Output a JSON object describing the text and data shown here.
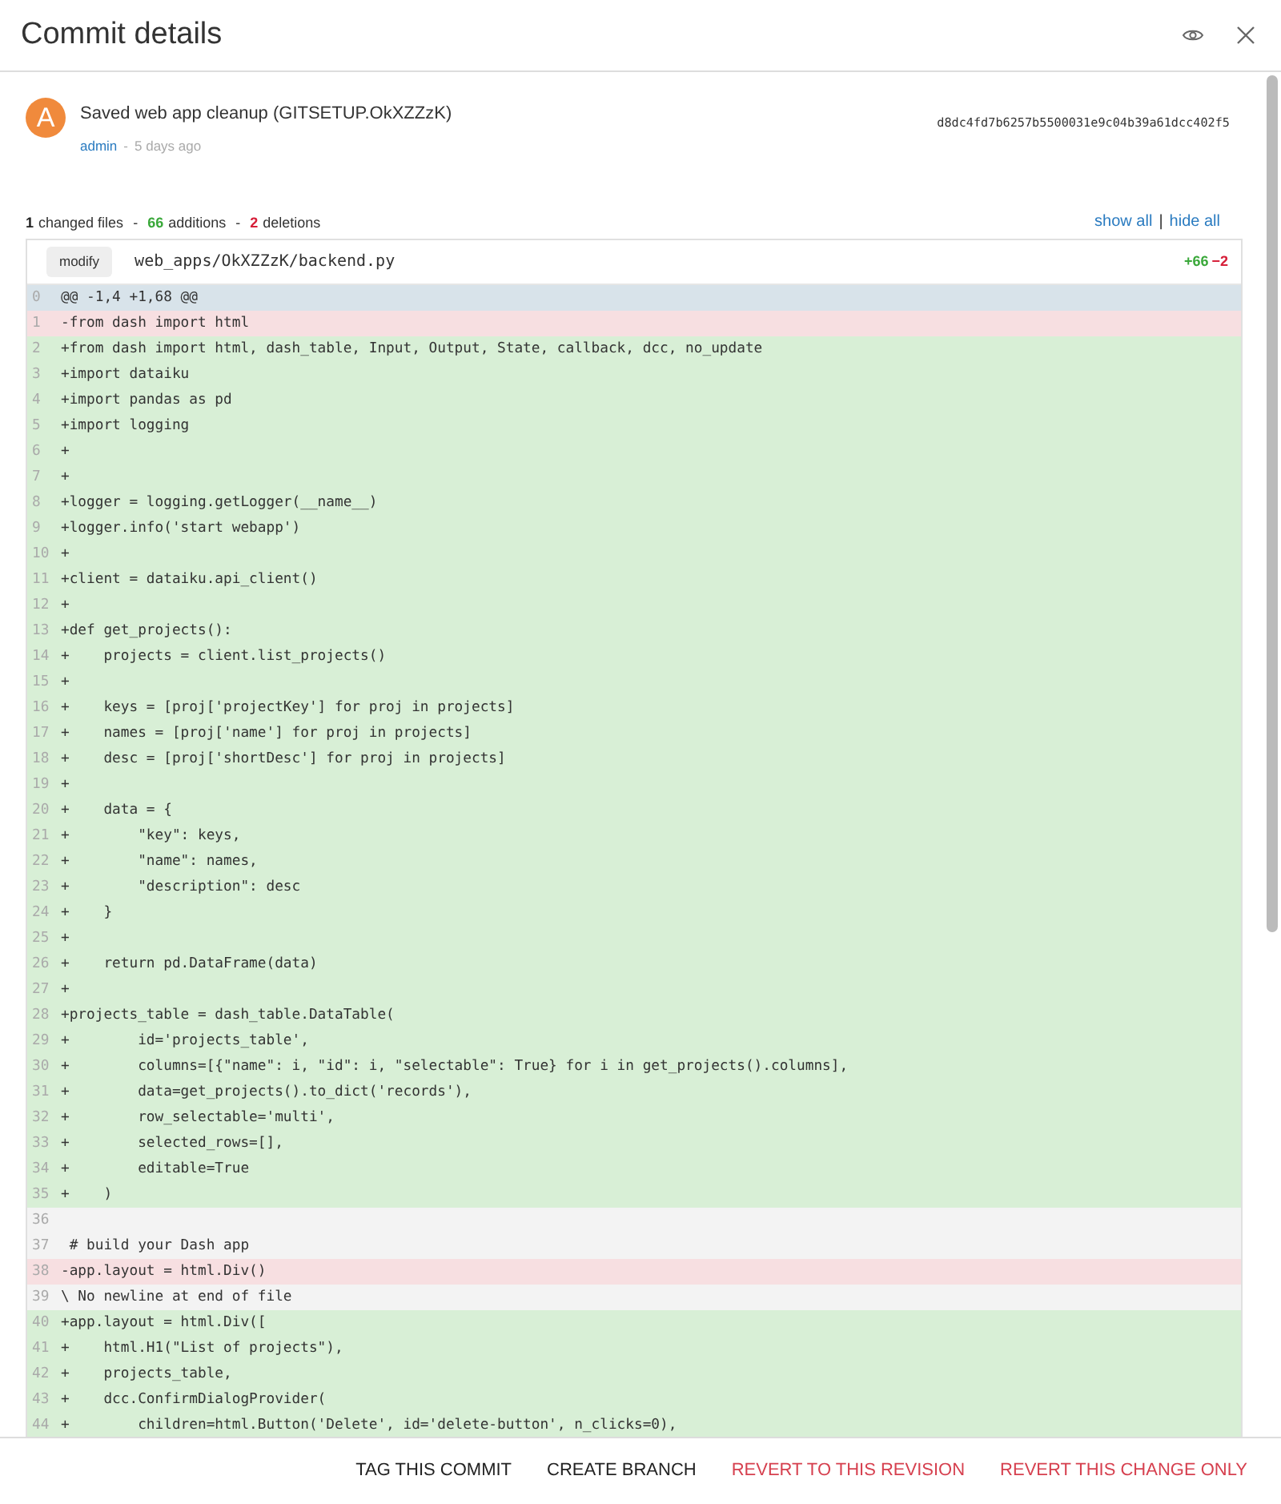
{
  "window": {
    "title": "Commit details"
  },
  "commit": {
    "avatar": "A",
    "message": "Saved web app cleanup (GITSETUP.OkXZZzK)",
    "author": "admin",
    "separator": "-",
    "time": "5 days ago",
    "hash": "d8dc4fd7b6257b5500031e9c04b39a61dcc402f5"
  },
  "stats": [
    {
      "kind": "files",
      "count": "1",
      "noun": "changed files"
    },
    {
      "kind": "additions",
      "count": "66",
      "noun": "additions"
    },
    {
      "kind": "deletions",
      "count": "2",
      "noun": "deletions"
    }
  ],
  "stats_separator": "-",
  "toggles": {
    "show": "show all",
    "divider": "|",
    "hide": "hide all"
  },
  "file": {
    "action": "modify",
    "path": "web_apps/OkXZZzK/backend.py",
    "additions": "+66",
    "deletions": "−2"
  },
  "diff": [
    {
      "no": "0",
      "kind": "hunk",
      "text": "@@ -1,4 +1,68 @@"
    },
    {
      "no": "1",
      "kind": "del",
      "text": "-from dash import html"
    },
    {
      "no": "2",
      "kind": "add",
      "text": "+from dash import html, dash_table, Input, Output, State, callback, dcc, no_update"
    },
    {
      "no": "3",
      "kind": "add",
      "text": "+import dataiku"
    },
    {
      "no": "4",
      "kind": "add",
      "text": "+import pandas as pd"
    },
    {
      "no": "5",
      "kind": "add",
      "text": "+import logging"
    },
    {
      "no": "6",
      "kind": "add",
      "text": "+"
    },
    {
      "no": "7",
      "kind": "add",
      "text": "+"
    },
    {
      "no": "8",
      "kind": "add",
      "text": "+logger = logging.getLogger(__name__)"
    },
    {
      "no": "9",
      "kind": "add",
      "text": "+logger.info('start webapp')"
    },
    {
      "no": "10",
      "kind": "add",
      "text": "+"
    },
    {
      "no": "11",
      "kind": "add",
      "text": "+client = dataiku.api_client()"
    },
    {
      "no": "12",
      "kind": "add",
      "text": "+"
    },
    {
      "no": "13",
      "kind": "add",
      "text": "+def get_projects():"
    },
    {
      "no": "14",
      "kind": "add",
      "text": "+    projects = client.list_projects()"
    },
    {
      "no": "15",
      "kind": "add",
      "text": "+"
    },
    {
      "no": "16",
      "kind": "add",
      "text": "+    keys = [proj['projectKey'] for proj in projects]"
    },
    {
      "no": "17",
      "kind": "add",
      "text": "+    names = [proj['name'] for proj in projects]"
    },
    {
      "no": "18",
      "kind": "add",
      "text": "+    desc = [proj['shortDesc'] for proj in projects]"
    },
    {
      "no": "19",
      "kind": "add",
      "text": "+"
    },
    {
      "no": "20",
      "kind": "add",
      "text": "+    data = {"
    },
    {
      "no": "21",
      "kind": "add",
      "text": "+        \"key\": keys,"
    },
    {
      "no": "22",
      "kind": "add",
      "text": "+        \"name\": names,"
    },
    {
      "no": "23",
      "kind": "add",
      "text": "+        \"description\": desc"
    },
    {
      "no": "24",
      "kind": "add",
      "text": "+    }"
    },
    {
      "no": "25",
      "kind": "add",
      "text": "+"
    },
    {
      "no": "26",
      "kind": "add",
      "text": "+    return pd.DataFrame(data)"
    },
    {
      "no": "27",
      "kind": "add",
      "text": "+"
    },
    {
      "no": "28",
      "kind": "add",
      "text": "+projects_table = dash_table.DataTable("
    },
    {
      "no": "29",
      "kind": "add",
      "text": "+        id='projects_table',"
    },
    {
      "no": "30",
      "kind": "add",
      "text": "+        columns=[{\"name\": i, \"id\": i, \"selectable\": True} for i in get_projects().columns],"
    },
    {
      "no": "31",
      "kind": "add",
      "text": "+        data=get_projects().to_dict('records'),"
    },
    {
      "no": "32",
      "kind": "add",
      "text": "+        row_selectable='multi',"
    },
    {
      "no": "33",
      "kind": "add",
      "text": "+        selected_rows=[],"
    },
    {
      "no": "34",
      "kind": "add",
      "text": "+        editable=True"
    },
    {
      "no": "35",
      "kind": "add",
      "text": "+    )"
    },
    {
      "no": "36",
      "kind": "ctx"
    },
    {
      "no": "37",
      "kind": "ctx",
      "text": " # build your Dash app"
    },
    {
      "no": "38",
      "kind": "del",
      "text": "-app.layout = html.Div()"
    },
    {
      "no": "39",
      "kind": "ctx",
      "text": "\\ No newline at end of file"
    },
    {
      "no": "40",
      "kind": "add",
      "text": "+app.layout = html.Div(["
    },
    {
      "no": "41",
      "kind": "add",
      "text": "+    html.H1(\"List of projects\"),"
    },
    {
      "no": "42",
      "kind": "add",
      "text": "+    projects_table,"
    },
    {
      "no": "43",
      "kind": "add",
      "text": "+    dcc.ConfirmDialogProvider("
    },
    {
      "no": "44",
      "kind": "add",
      "text": "+        children=html.Button('Delete', id='delete-button', n_clicks=0),"
    }
  ],
  "actions": [
    {
      "label": "TAG THIS COMMIT",
      "kind": "neutral"
    },
    {
      "label": "CREATE BRANCH",
      "kind": "neutral"
    },
    {
      "label": "REVERT TO THIS REVISION",
      "kind": "danger"
    },
    {
      "label": "REVERT THIS CHANGE ONLY",
      "kind": "danger"
    }
  ]
}
